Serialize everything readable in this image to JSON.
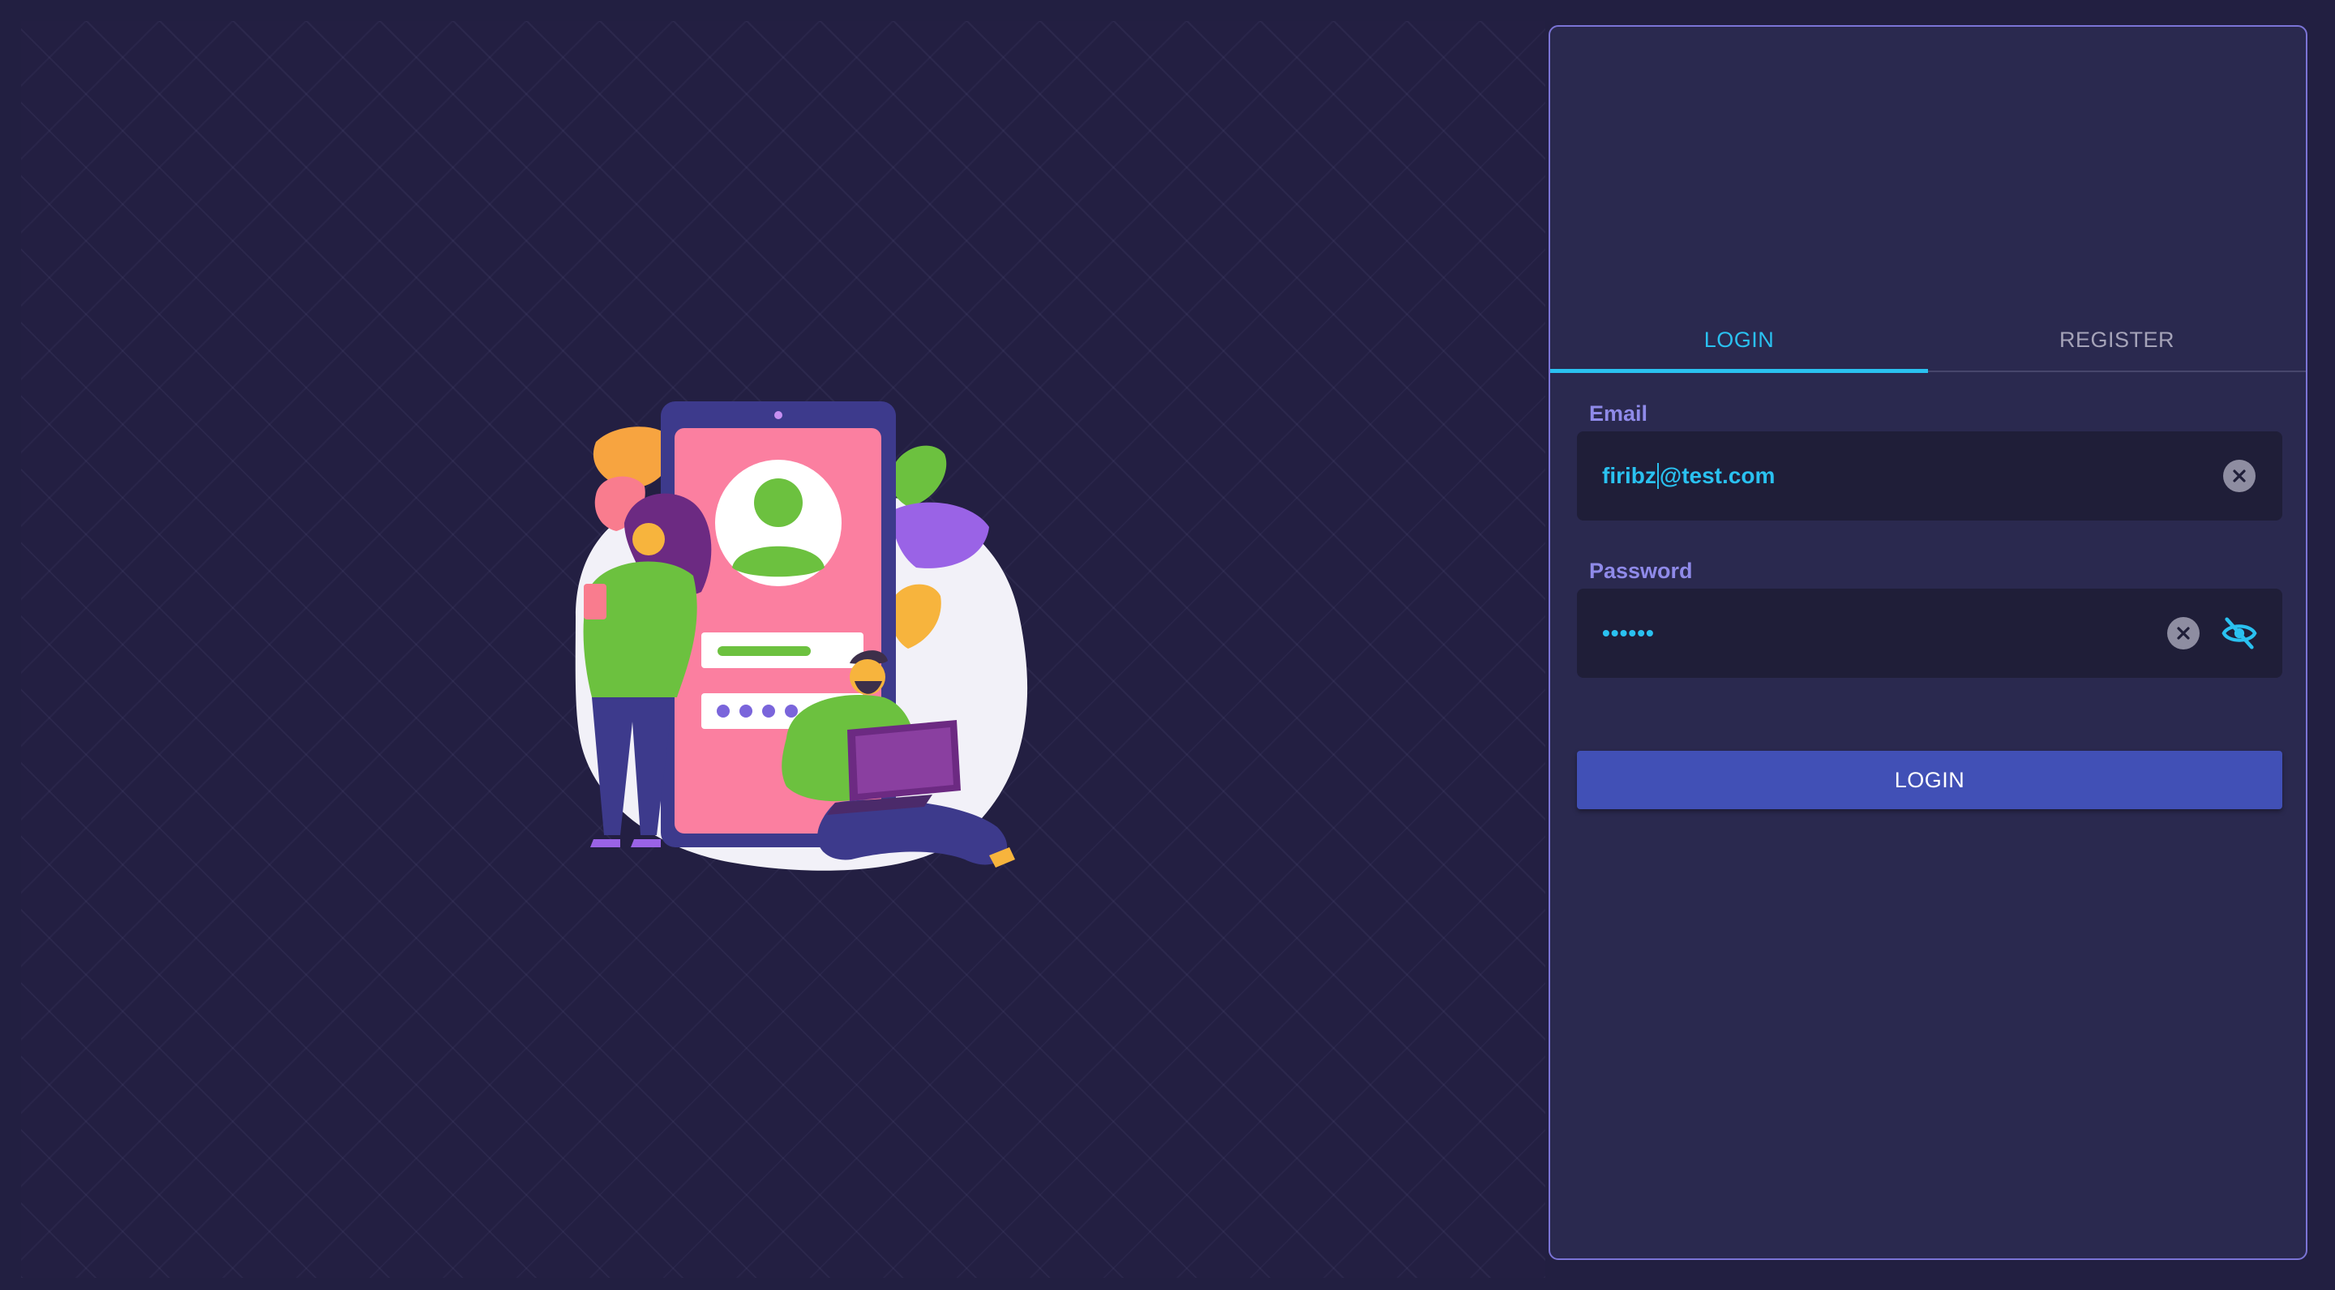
{
  "tabs": {
    "login_label": "LOGIN",
    "register_label": "REGISTER"
  },
  "email": {
    "label": "Email",
    "value_before_caret": "firibz",
    "value_after_caret": "@test.com"
  },
  "password": {
    "label": "Password",
    "value": "••••••"
  },
  "actions": {
    "login_label": "LOGIN"
  },
  "icons": {
    "email_clear": "close-circle-icon",
    "password_clear": "close-circle-icon",
    "password_visibility": "eye-off-icon"
  },
  "colors": {
    "accent": "#2ac1f0",
    "label": "#8f8ae9",
    "button": "#4150b6",
    "panel": "#2a294f",
    "background": "#221f41"
  }
}
